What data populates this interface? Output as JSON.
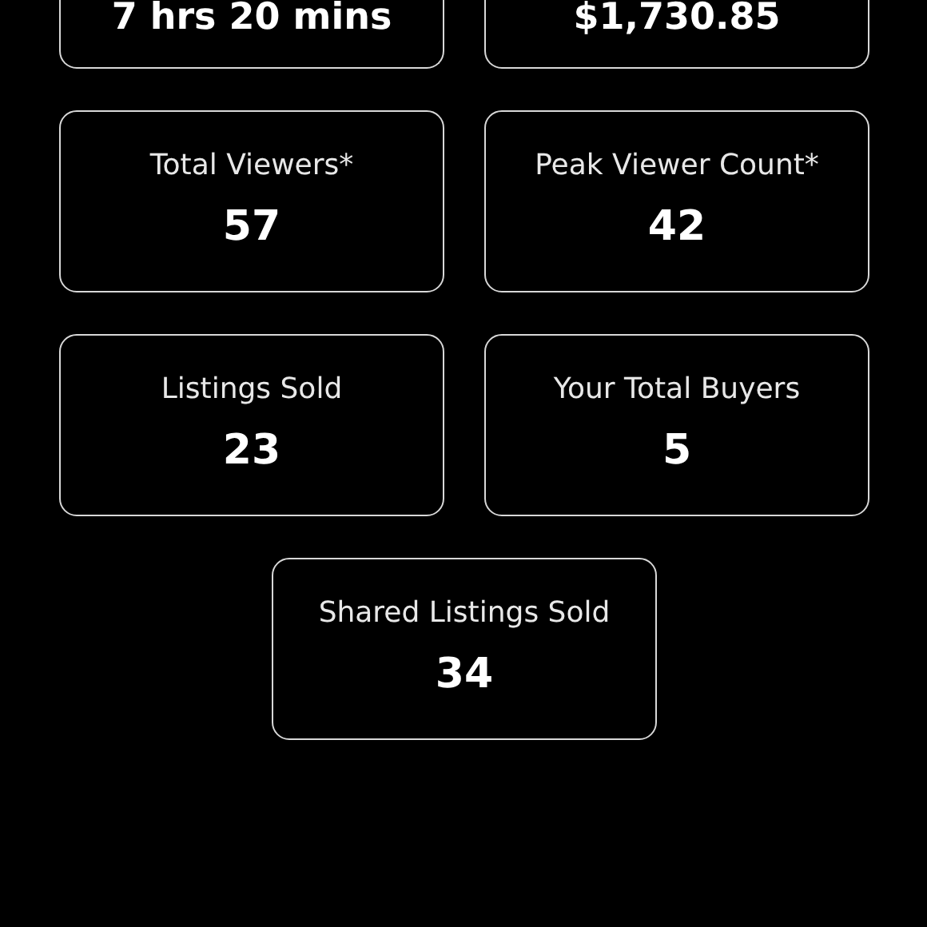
{
  "stats": [
    {
      "kind": "value_only",
      "value": "7 hrs 20 mins"
    },
    {
      "kind": "value_only",
      "value": "$1,730.85"
    },
    {
      "kind": "full",
      "label": "Total Viewers*",
      "value": "57"
    },
    {
      "kind": "full",
      "label": "Peak Viewer Count*",
      "value": "42"
    },
    {
      "kind": "full",
      "label": "Listings Sold",
      "value": "23"
    },
    {
      "kind": "full",
      "label": "Your Total Buyers",
      "value": "5"
    },
    {
      "kind": "full",
      "label": "Shared Listings Sold",
      "value": "34"
    }
  ]
}
